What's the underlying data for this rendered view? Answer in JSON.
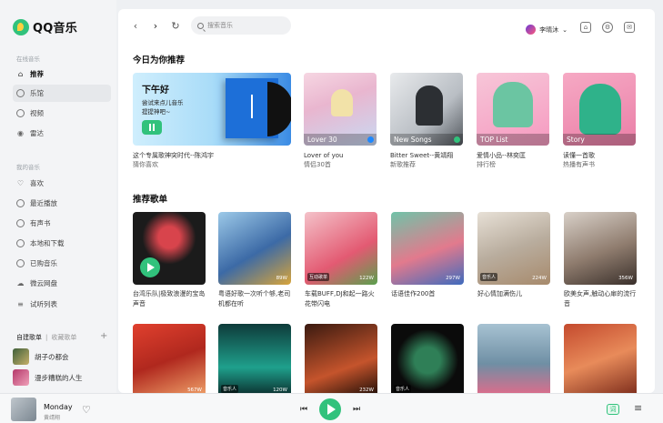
{
  "app": {
    "logo": "QQ音乐"
  },
  "sidebar": {
    "online_label": "在线音乐",
    "online_items": [
      {
        "label": "推荐",
        "icon": "home-icon"
      },
      {
        "label": "乐馆",
        "icon": "disc-icon"
      },
      {
        "label": "视频",
        "icon": "video-icon"
      },
      {
        "label": "雷达",
        "icon": "radar-icon"
      }
    ],
    "my_label": "我的音乐",
    "my_items": [
      {
        "label": "喜欢",
        "icon": "heart-icon"
      },
      {
        "label": "最近播放",
        "icon": "clock-icon"
      },
      {
        "label": "有声书",
        "icon": "headphones-icon"
      },
      {
        "label": "本地和下载",
        "icon": "download-icon"
      },
      {
        "label": "已购音乐",
        "icon": "bag-icon"
      },
      {
        "label": "微云网盘",
        "icon": "cloud-icon"
      },
      {
        "label": "试听列表",
        "icon": "list-icon"
      }
    ],
    "playlist_tab_created": "自建歌单",
    "playlist_tab_collected": "收藏歌单",
    "playlists": [
      {
        "label": "胡子の都会"
      },
      {
        "label": "漫步糟糕的人生"
      }
    ]
  },
  "topbar": {
    "search_placeholder": "搜索音乐",
    "username": "李晴沐"
  },
  "daily": {
    "title": "今日为你推荐",
    "feature": {
      "greeting": "下午好",
      "line1": "尝试来点儿音乐",
      "line2": "提提神吧~",
      "caption1": "这个专属歌神突时代--陈鸿宇",
      "caption2": "猜你喜欢"
    },
    "cards": [
      {
        "overlay": "Lover 30",
        "caption1": "Lover of you",
        "caption2": "情侣30首"
      },
      {
        "overlay": "New Songs",
        "caption1": "Bitter Sweet--黄靖翔",
        "caption2": "新歌推荐"
      },
      {
        "overlay": "TOP List",
        "caption1": "爱情小品--林奕匡",
        "caption2": "排行榜"
      },
      {
        "overlay": "Story",
        "caption1": "读懂一首歌",
        "caption2": "热播有声书"
      }
    ]
  },
  "playlists_rec": {
    "title": "推荐歌单",
    "row1": [
      {
        "caption": "台湾乐队|极致浪漫的宝岛声音",
        "badge": "",
        "count": ""
      },
      {
        "caption": "粤语好歌一次听个够,老司机都在听",
        "badge": "",
        "count": "89W"
      },
      {
        "caption": "车载BUFF,DJ和起一路火花带闪电",
        "badge": "互动歌单",
        "count": "122W"
      },
      {
        "caption": "话语佳作200首",
        "badge": "",
        "count": "297W"
      },
      {
        "caption": "好心情加满伤儿",
        "badge": "音乐人",
        "count": "224W"
      },
      {
        "caption": "欧美女声,触动心扉的流行音",
        "badge": "",
        "count": "356W"
      }
    ],
    "row2": [
      {
        "badge": "",
        "count": "567W"
      },
      {
        "badge": "音乐人",
        "count": "120W"
      },
      {
        "badge": "",
        "count": "232W"
      },
      {
        "badge": "音乐人",
        "count": ""
      },
      {
        "badge": "",
        "count": ""
      },
      {
        "badge": "",
        "count": ""
      }
    ]
  },
  "player": {
    "title": "Monday",
    "artist": "黄靖翔",
    "lyric_label": "词"
  },
  "colors": {
    "accent": "#31c27c"
  }
}
